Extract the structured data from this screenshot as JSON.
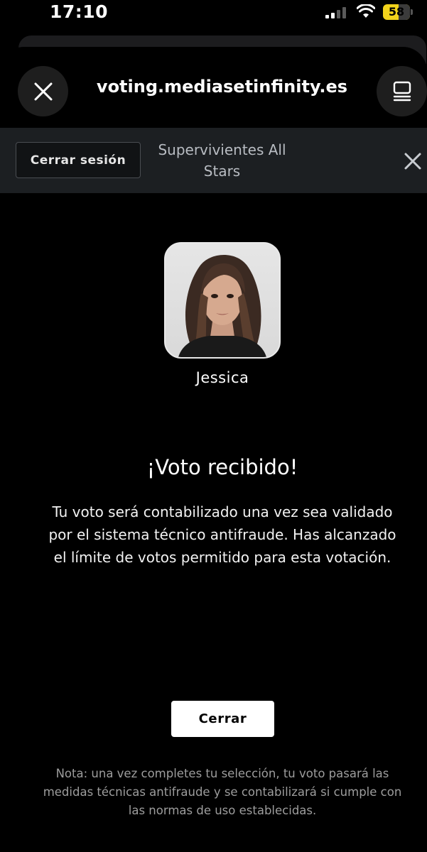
{
  "status_bar": {
    "time": "17:10",
    "battery_level": "58",
    "battery_color": "#f2d31b"
  },
  "browser": {
    "url": "voting.mediasetinfinity.es",
    "close_icon": "close-icon",
    "tabs_icon": "tabs-icon"
  },
  "header": {
    "logout_label": "Cerrar sesión",
    "program_title": "Supervivientes All Stars",
    "close_icon": "close-icon"
  },
  "main": {
    "contestant_name": "Jessica",
    "heading": "¡Voto recibido!",
    "message": "Tu voto será contabilizado una vez sea validado por el sistema técnico antifraude. Has alcanzado el límite de votos permitido para esta votación.",
    "close_button": "Cerrar",
    "note": "Nota: una vez completes tu selección, tu voto pasará las medidas técnicas antifraude y se contabilizará si cumple con las normas de uso establecidas."
  }
}
